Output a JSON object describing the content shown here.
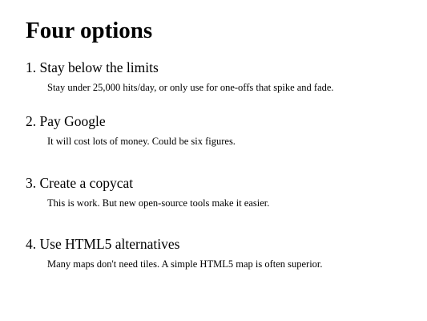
{
  "slide": {
    "title": "Four options",
    "options": [
      {
        "heading": "1. Stay below the limits",
        "description": "Stay under 25,000 hits/day, or only use for one-offs that spike and fade."
      },
      {
        "heading": "2. Pay Google",
        "description": "It will cost lots of money. Could be six figures."
      },
      {
        "heading": "3. Create a copycat",
        "description": "This is work. But new open-source tools make it easier."
      },
      {
        "heading": "4. Use HTML5 alternatives",
        "description": "Many maps don't need tiles. A simple HTML5 map is often superior."
      }
    ]
  }
}
